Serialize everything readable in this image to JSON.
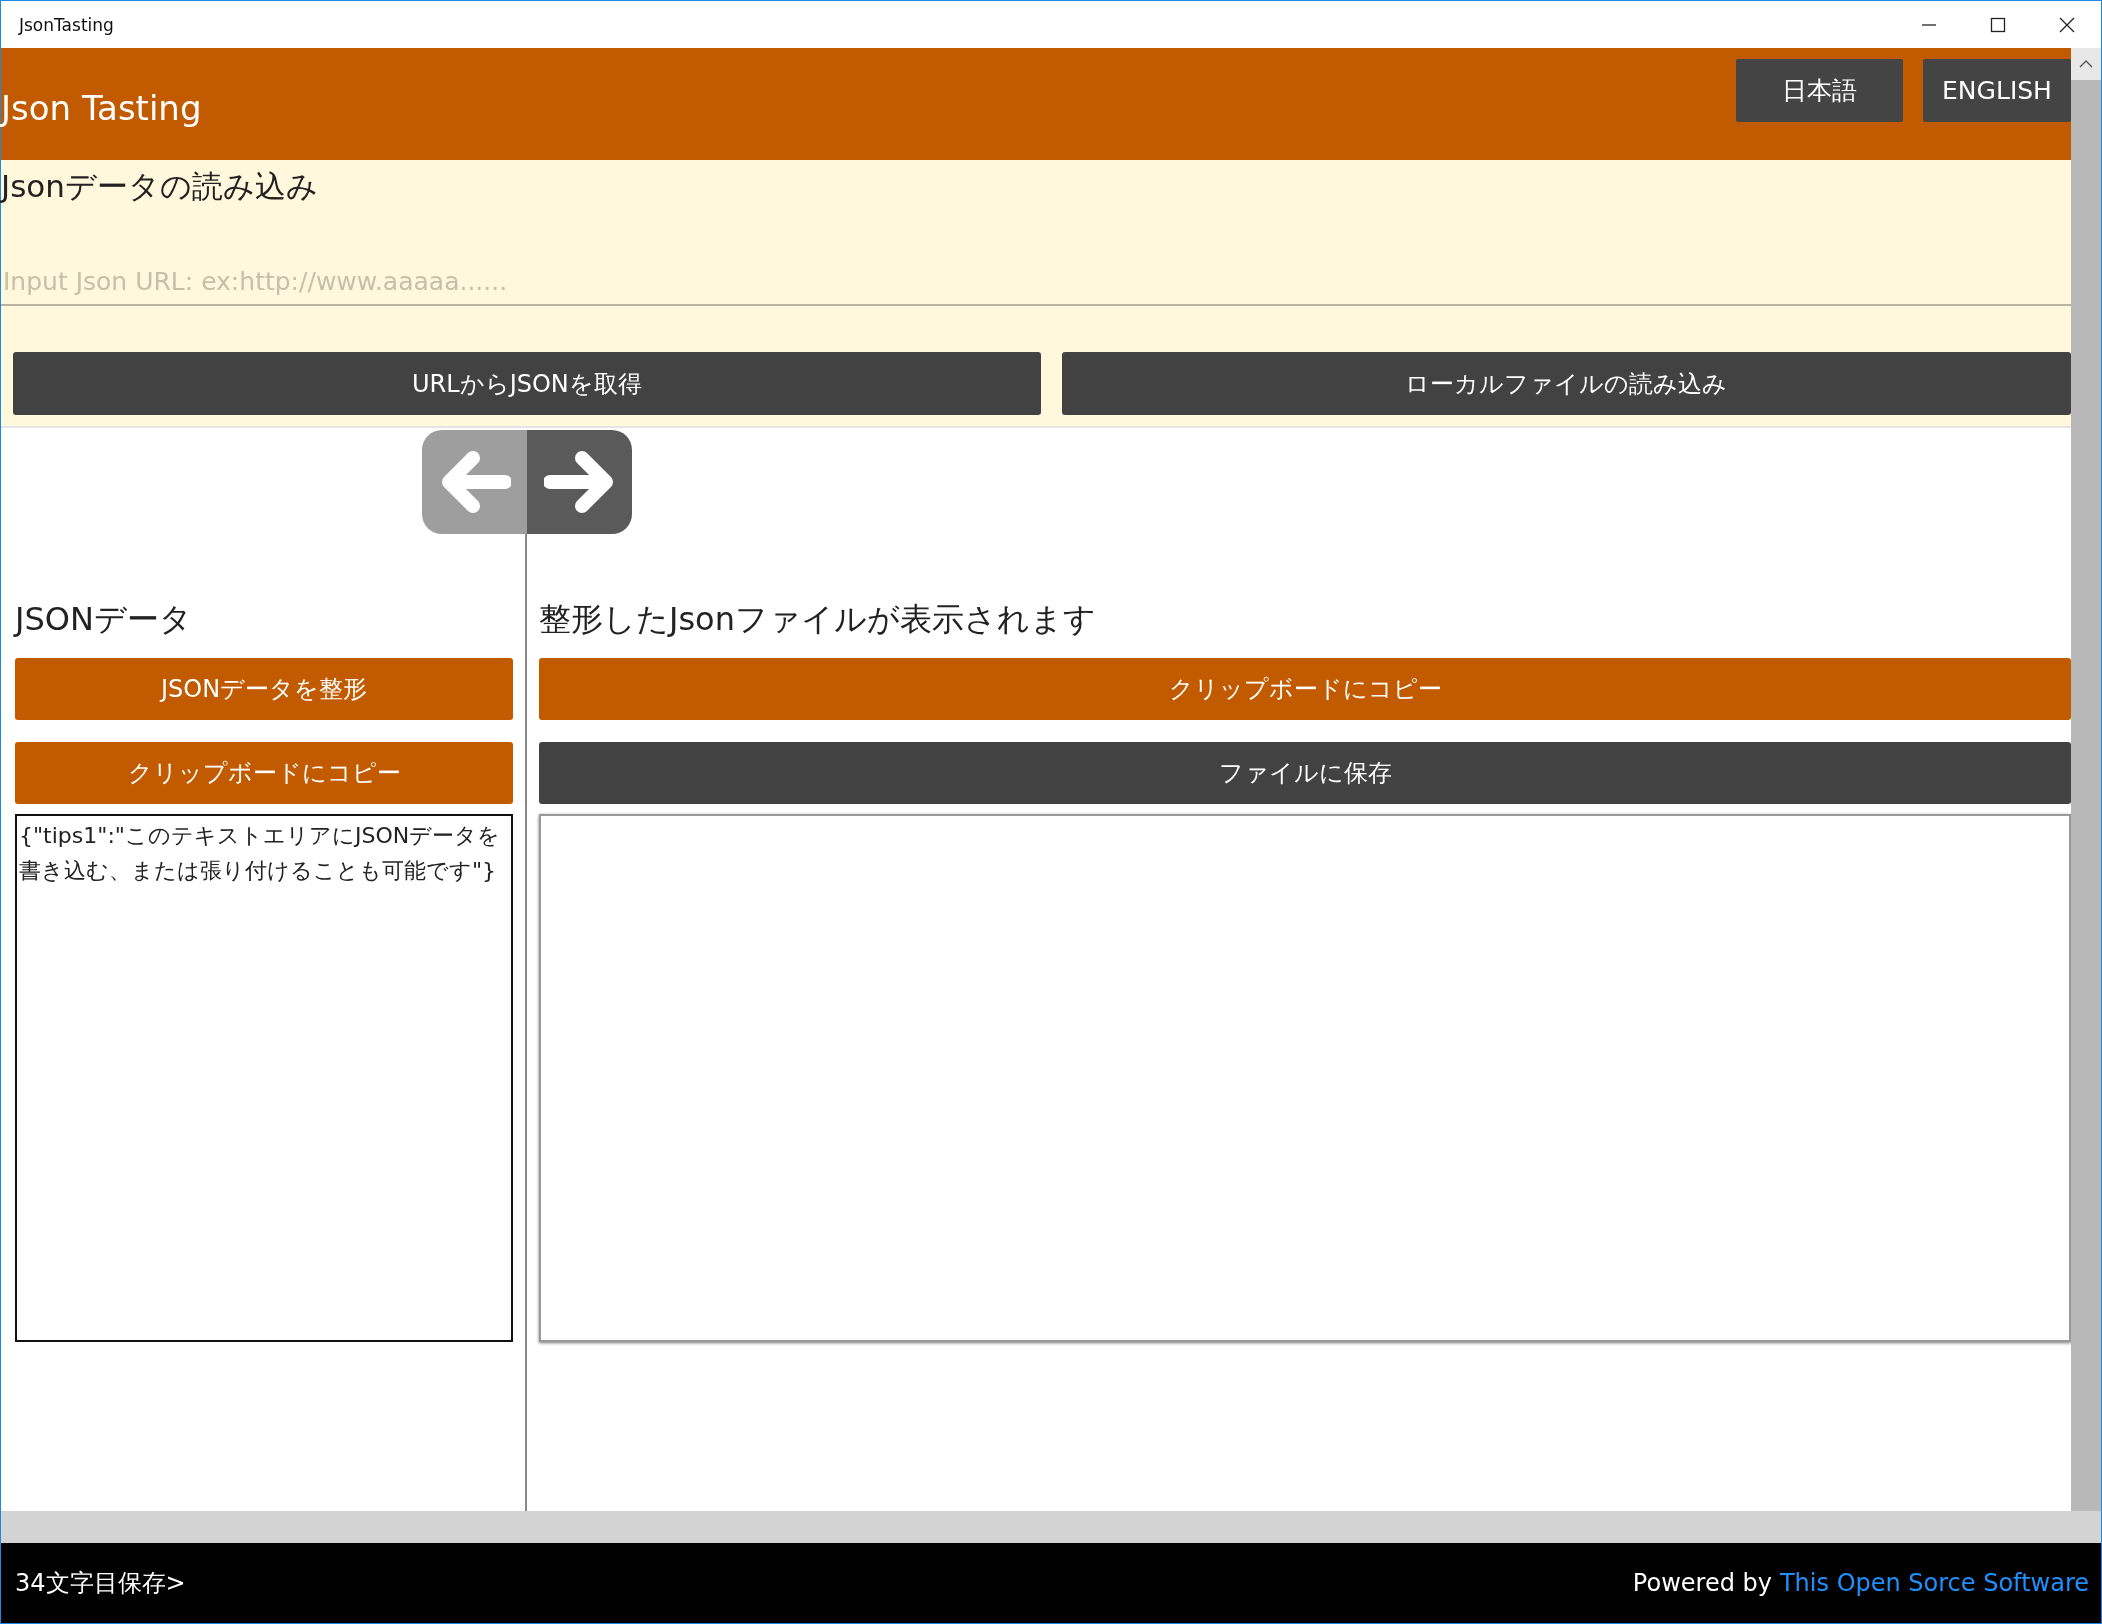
{
  "window": {
    "title": "JsonTasting"
  },
  "header": {
    "title": "Json Tasting",
    "languages": [
      {
        "label": "日本語"
      },
      {
        "label": "ENGLISH"
      }
    ]
  },
  "load": {
    "heading": "Jsonデータの読み込み",
    "url_field": {
      "placeholder": "Input Json URL: ex:http://www.aaaaa......"
    },
    "buttons": [
      "URLからJSONを取得",
      "ローカルファイルの読み込み"
    ]
  },
  "nav_buttons": [
    {
      "kind": "back",
      "disabled": true
    },
    {
      "kind": "forward",
      "disabled": false
    }
  ],
  "left": {
    "heading": "JSONデータ",
    "buttons": [
      {
        "label": "JSONデータを整形",
        "kind": "accent"
      },
      {
        "label": "クリップボードにコピー",
        "kind": "accent"
      }
    ],
    "text": "{\"tips1\":\"このテキストエリアにJSONデータを書き込む、または張り付けることも可能です\"}"
  },
  "right": {
    "heading": "整形したJsonファイルが表示されます",
    "buttons": [
      {
        "label": "クリップボードにコピー",
        "kind": "accent"
      },
      {
        "label": "ファイルに保存",
        "kind": "dark"
      }
    ]
  },
  "status_bar": {
    "left": "34文字目保存>",
    "powered_by": "Powered by",
    "link": "This Open Sorce Software"
  }
}
